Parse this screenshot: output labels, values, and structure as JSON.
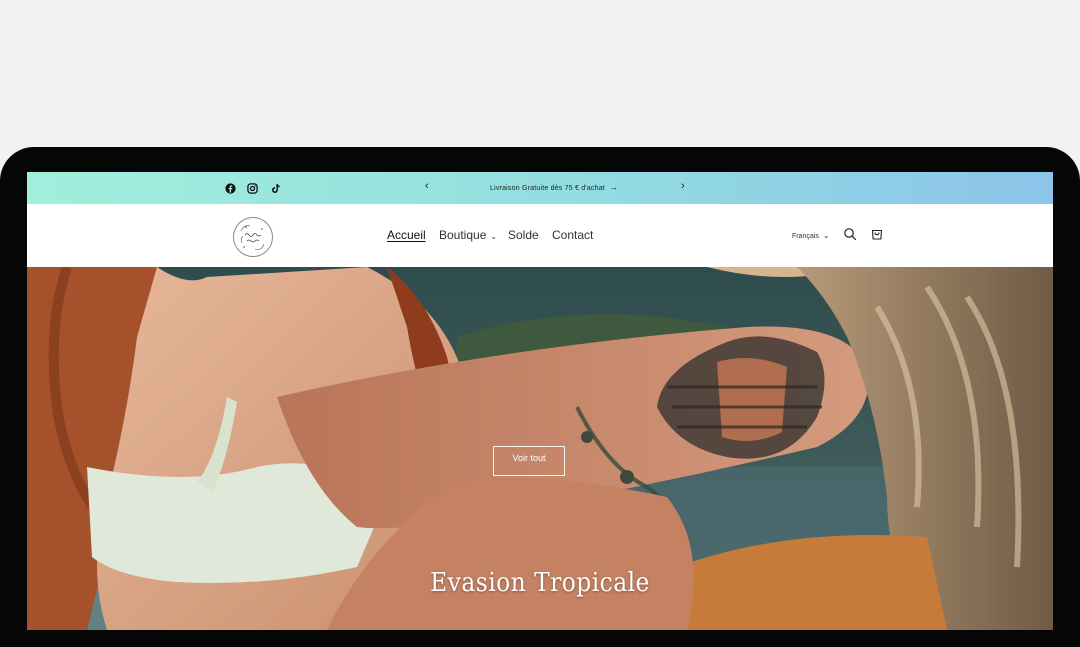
{
  "announcement": {
    "social": [
      {
        "icon": "facebook-icon"
      },
      {
        "icon": "instagram-icon"
      },
      {
        "icon": "tiktok-icon"
      }
    ],
    "prev_arrow": "‹",
    "next_arrow": "›",
    "message": "Livraison Gratuite dès 75 € d'achat",
    "message_arrow": "→",
    "gradient": [
      "#a2eedc",
      "#93dfe0",
      "#8cc4ea"
    ]
  },
  "header": {
    "logo_alt": "Evasion Tropicale",
    "nav": [
      {
        "label": "Accueil",
        "active": true
      },
      {
        "label": "Boutique",
        "dropdown": true
      },
      {
        "label": "Solde"
      },
      {
        "label": "Contact"
      }
    ],
    "caret": "⌄",
    "language": "Français",
    "icons": [
      "search-icon",
      "cart-icon"
    ]
  },
  "hero": {
    "title": "Evasion Tropicale",
    "button_label": "Voir tout"
  }
}
